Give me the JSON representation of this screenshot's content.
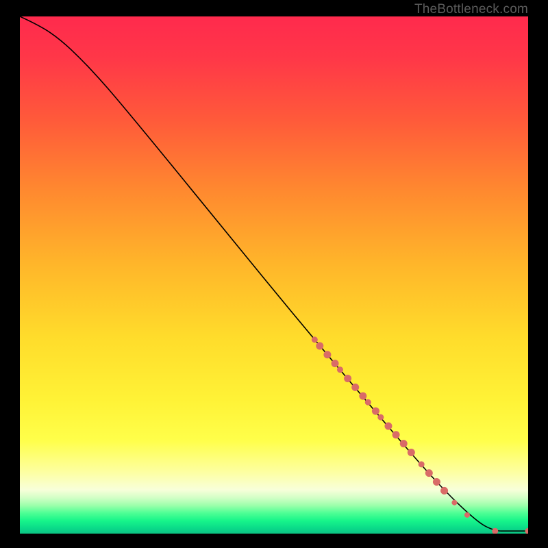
{
  "attrib": "TheBottleneck.com",
  "chart_data": {
    "type": "line",
    "title": "",
    "xlabel": "",
    "ylabel": "",
    "xlim": [
      0,
      100
    ],
    "ylim": [
      0,
      100
    ],
    "curve": [
      {
        "x": 0,
        "y": 100
      },
      {
        "x": 4,
        "y": 98.2
      },
      {
        "x": 8,
        "y": 95.5
      },
      {
        "x": 12,
        "y": 91.8
      },
      {
        "x": 16,
        "y": 87.6
      },
      {
        "x": 20,
        "y": 83.0
      },
      {
        "x": 28,
        "y": 73.5
      },
      {
        "x": 40,
        "y": 59.0
      },
      {
        "x": 55,
        "y": 41.0
      },
      {
        "x": 70,
        "y": 23.5
      },
      {
        "x": 82,
        "y": 9.8
      },
      {
        "x": 90,
        "y": 2.2
      },
      {
        "x": 93.5,
        "y": 0.5
      },
      {
        "x": 96,
        "y": 0.5
      },
      {
        "x": 100,
        "y": 0.5
      }
    ],
    "markers": [
      {
        "x": 58.0,
        "y": 37.5,
        "r": 4.5
      },
      {
        "x": 59.0,
        "y": 36.3,
        "r": 5.5
      },
      {
        "x": 60.5,
        "y": 34.6,
        "r": 5.5
      },
      {
        "x": 62.0,
        "y": 32.9,
        "r": 5.5
      },
      {
        "x": 63.0,
        "y": 31.7,
        "r": 4.5
      },
      {
        "x": 64.5,
        "y": 30.0,
        "r": 5.5
      },
      {
        "x": 66.0,
        "y": 28.3,
        "r": 5.5
      },
      {
        "x": 67.5,
        "y": 26.6,
        "r": 5.5
      },
      {
        "x": 68.5,
        "y": 25.4,
        "r": 4.5
      },
      {
        "x": 70.0,
        "y": 23.7,
        "r": 5.5
      },
      {
        "x": 71.0,
        "y": 22.5,
        "r": 4.5
      },
      {
        "x": 72.5,
        "y": 20.8,
        "r": 5.5
      },
      {
        "x": 74.0,
        "y": 19.1,
        "r": 5.5
      },
      {
        "x": 75.5,
        "y": 17.4,
        "r": 5.5
      },
      {
        "x": 77.0,
        "y": 15.7,
        "r": 5.5
      },
      {
        "x": 79.0,
        "y": 13.4,
        "r": 4.5
      },
      {
        "x": 80.5,
        "y": 11.7,
        "r": 5.5
      },
      {
        "x": 82.0,
        "y": 10.0,
        "r": 5.5
      },
      {
        "x": 83.5,
        "y": 8.3,
        "r": 5.5
      },
      {
        "x": 85.5,
        "y": 6.0,
        "r": 4.0
      },
      {
        "x": 88.0,
        "y": 3.6,
        "r": 4.0
      },
      {
        "x": 93.5,
        "y": 0.5,
        "r": 4.5
      },
      {
        "x": 100.0,
        "y": 0.5,
        "r": 4.5
      }
    ],
    "marker_color": "#d96b67",
    "line_color": "#000000",
    "gradient_stops": [
      {
        "offset": 0.0,
        "color": "#ff2a4d"
      },
      {
        "offset": 0.08,
        "color": "#ff3748"
      },
      {
        "offset": 0.2,
        "color": "#ff5a3a"
      },
      {
        "offset": 0.34,
        "color": "#ff8a2f"
      },
      {
        "offset": 0.48,
        "color": "#ffb62a"
      },
      {
        "offset": 0.62,
        "color": "#ffdc2b"
      },
      {
        "offset": 0.74,
        "color": "#fff236"
      },
      {
        "offset": 0.82,
        "color": "#ffff4a"
      },
      {
        "offset": 0.88,
        "color": "#fdffa0"
      },
      {
        "offset": 0.915,
        "color": "#f8ffda"
      },
      {
        "offset": 0.93,
        "color": "#d4ffc7"
      },
      {
        "offset": 0.945,
        "color": "#9effac"
      },
      {
        "offset": 0.96,
        "color": "#4fff95"
      },
      {
        "offset": 0.975,
        "color": "#17f58a"
      },
      {
        "offset": 0.99,
        "color": "#0ad989"
      },
      {
        "offset": 1.0,
        "color": "#0cc283"
      }
    ]
  }
}
